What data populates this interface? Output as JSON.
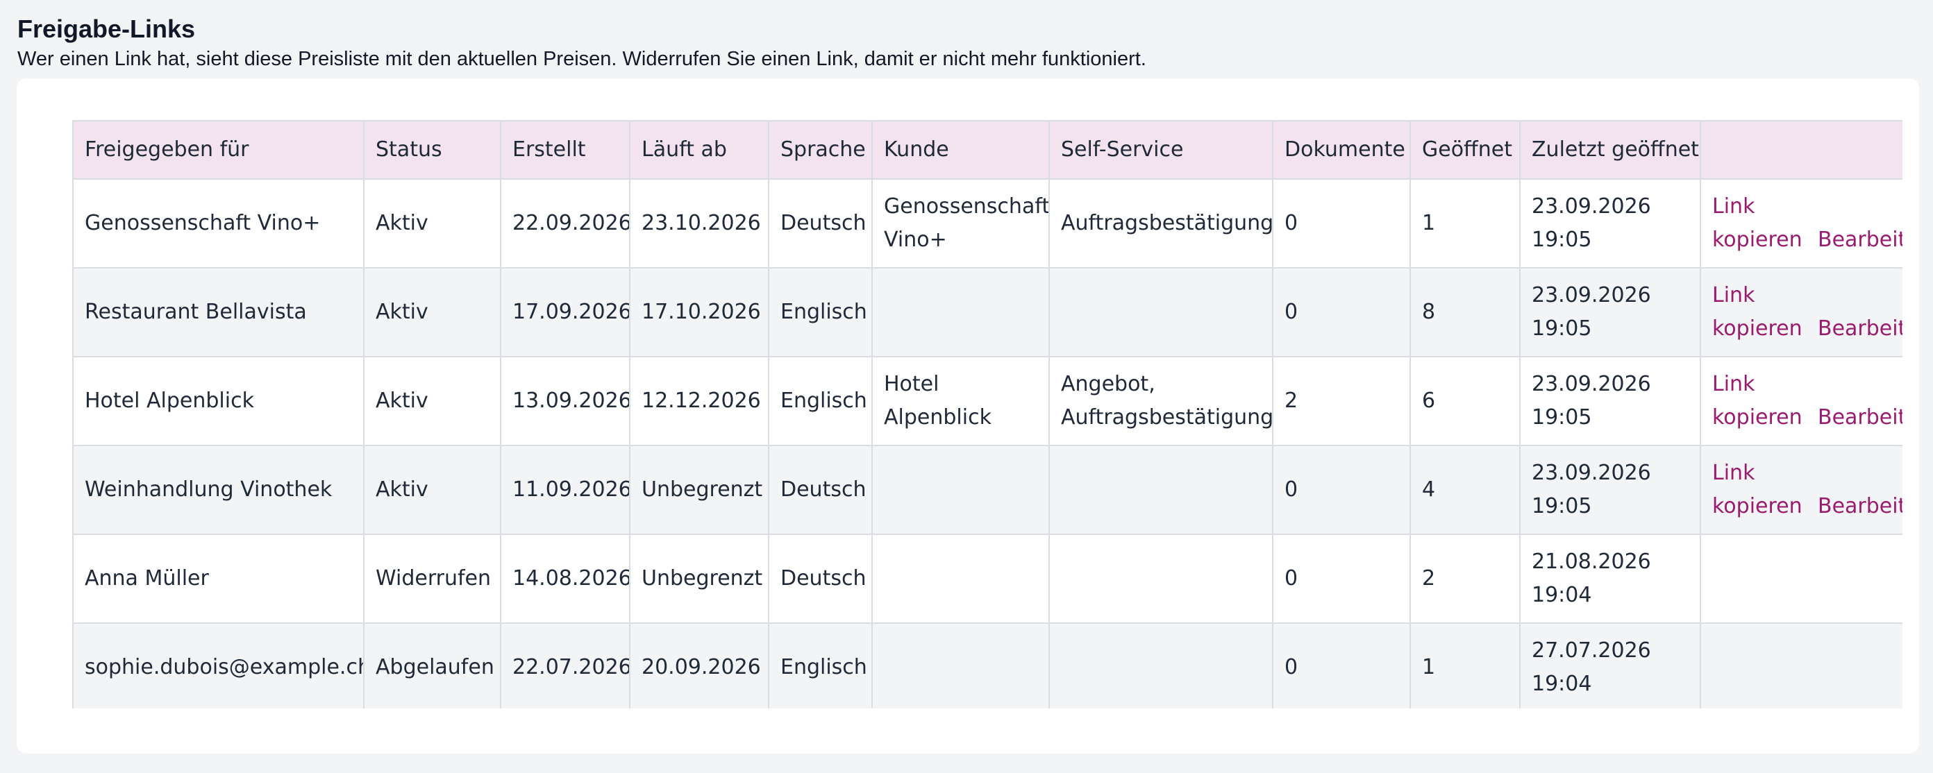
{
  "header": {
    "title": "Freigabe-Links",
    "subtitle": "Wer einen Link hat, sieht diese Preisliste mit den aktuellen Preisen. Widerrufen Sie einen Link, damit er nicht mehr funktioniert."
  },
  "table": {
    "columns": [
      "Freigegeben für",
      "Status",
      "Erstellt",
      "Läuft ab",
      "Sprache",
      "Kunde",
      "Self-Service",
      "Dokumente",
      "Geöffnet",
      "Zuletzt geöffnet",
      ""
    ],
    "rows": [
      {
        "shared_for": "Genossenschaft Vino+",
        "status": "Aktiv",
        "created": "22.09.2026",
        "expires": "23.10.2026",
        "language": "Deutsch",
        "customer": "Genossenschaft Vino+",
        "self_service": "Auftragsbestätigung",
        "documents": "0",
        "opened": "1",
        "last_opened": "23.09.2026 19:05",
        "action_copy": "Link kopieren",
        "action_edit": "Bearbeiten"
      },
      {
        "shared_for": "Restaurant Bellavista",
        "status": "Aktiv",
        "created": "17.09.2026",
        "expires": "17.10.2026",
        "language": "Englisch",
        "customer": "",
        "self_service": "",
        "documents": "0",
        "opened": "8",
        "last_opened": "23.09.2026 19:05",
        "action_copy": "Link kopieren",
        "action_edit": "Bearbeiten"
      },
      {
        "shared_for": "Hotel Alpenblick",
        "status": "Aktiv",
        "created": "13.09.2026",
        "expires": "12.12.2026",
        "language": "Englisch",
        "customer": "Hotel Alpenblick",
        "self_service": "Angebot, Auftragsbestätigung",
        "documents": "2",
        "opened": "6",
        "last_opened": "23.09.2026 19:05",
        "action_copy": "Link kopieren",
        "action_edit": "Bearbeiten"
      },
      {
        "shared_for": "Weinhandlung Vinothek",
        "status": "Aktiv",
        "created": "11.09.2026",
        "expires": "Unbegrenzt",
        "language": "Deutsch",
        "customer": "",
        "self_service": "",
        "documents": "0",
        "opened": "4",
        "last_opened": "23.09.2026 19:05",
        "action_copy": "Link kopieren",
        "action_edit": "Bearbeiten"
      },
      {
        "shared_for": "Anna Müller",
        "status": "Widerrufen",
        "created": "14.08.2026",
        "expires": "Unbegrenzt",
        "language": "Deutsch",
        "customer": "",
        "self_service": "",
        "documents": "0",
        "opened": "2",
        "last_opened": "21.08.2026 19:04",
        "action_copy": "",
        "action_edit": ""
      },
      {
        "shared_for": "sophie.dubois@example.ch",
        "status": "Abgelaufen",
        "created": "22.07.2026",
        "expires": "20.09.2026",
        "language": "Englisch",
        "customer": "",
        "self_service": "",
        "documents": "0",
        "opened": "1",
        "last_opened": "27.07.2026 19:04",
        "action_copy": "",
        "action_edit": ""
      }
    ]
  },
  "colors": {
    "background": "#f3f4f6",
    "card": "#ffffff",
    "header_row": "#f3e3ef",
    "striped_row": "#f3f4f6",
    "border": "#d9dce1",
    "link": "#9b1b6e"
  }
}
